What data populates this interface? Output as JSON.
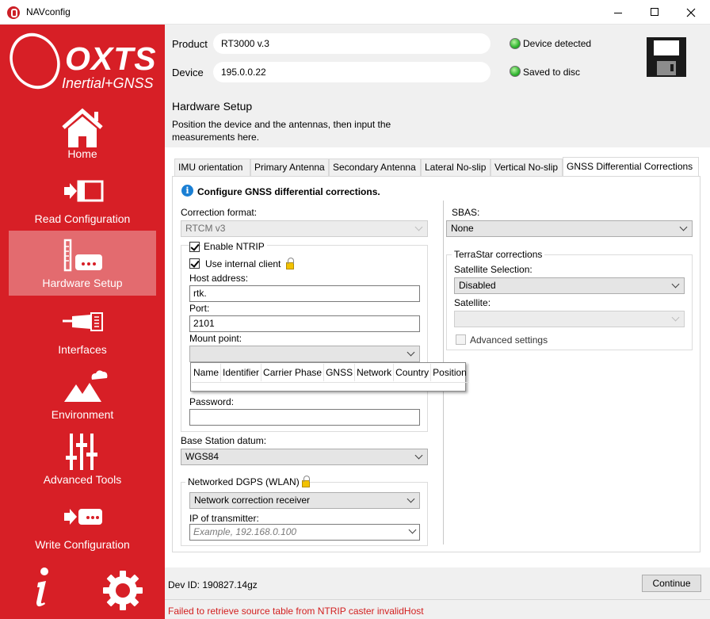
{
  "window": {
    "title": "NAVconfig",
    "controls": [
      "minimize",
      "maximize",
      "close"
    ]
  },
  "sidebar": {
    "logo": {
      "brand": "OXTS",
      "tagline": "Inertial+GNSS"
    },
    "items": [
      {
        "label": "Home",
        "icon": "home-icon",
        "active": false
      },
      {
        "label": "Read Configuration",
        "icon": "read-config-icon",
        "active": false
      },
      {
        "label": "Hardware Setup",
        "icon": "hardware-setup-icon",
        "active": true
      },
      {
        "label": "Interfaces",
        "icon": "interfaces-icon",
        "active": false
      },
      {
        "label": "Environment",
        "icon": "environment-icon",
        "active": false
      },
      {
        "label": "Advanced Tools",
        "icon": "advanced-tools-icon",
        "active": false
      },
      {
        "label": "Write Configuration",
        "icon": "write-config-icon",
        "active": false
      }
    ],
    "bottom_icons": [
      "info-icon",
      "settings-gear-icon"
    ]
  },
  "header": {
    "product_label": "Product",
    "product_value": "RT3000 v.3",
    "device_label": "Device",
    "device_value": "195.0.0.22",
    "status_device": "Device detected",
    "status_saved": "Saved to disc",
    "status_color": "#2fb52f",
    "save_icon": "floppy-disk-icon"
  },
  "page": {
    "title": "Hardware Setup",
    "description": "Position the device and the antennas, then input the measurements here."
  },
  "tabs": [
    {
      "label": "IMU orientation",
      "active": false
    },
    {
      "label": "Primary Antenna",
      "active": false
    },
    {
      "label": "Secondary Antenna",
      "active": false
    },
    {
      "label": "Lateral No-slip",
      "active": false
    },
    {
      "label": "Vertical No-slip",
      "active": false
    },
    {
      "label": "GNSS Differential Corrections",
      "active": true
    }
  ],
  "gnss": {
    "info_text": "Configure GNSS differential corrections.",
    "correction_format_label": "Correction format:",
    "correction_format_value": "RTCM v3",
    "enable_ntrip_label": "Enable NTRIP",
    "enable_ntrip_checked": true,
    "use_internal_client_label": "Use internal client",
    "use_internal_client_checked": true,
    "host_address_label": "Host address:",
    "host_address_value": "rtk.",
    "port_label": "Port:",
    "port_value": "2101",
    "mount_point_label": "Mount point:",
    "mount_point_value": "",
    "mount_point_columns": [
      "Name",
      "Identifier",
      "Carrier Phase",
      "GNSS",
      "Network",
      "Country",
      "Position"
    ],
    "password_label": "Password:",
    "password_value": "",
    "base_station_datum_label": "Base Station datum:",
    "base_station_datum_value": "WGS84",
    "networked_dgps_label": "Networked DGPS (WLAN)",
    "networked_dgps_mode_value": "Network correction receiver",
    "ip_transmitter_label": "IP of transmitter:",
    "ip_transmitter_placeholder": "Example, 192.168.0.100",
    "sbas_label": "SBAS:",
    "sbas_value": "None",
    "terrastar_title": "TerraStar corrections",
    "satellite_selection_label": "Satellite Selection:",
    "satellite_selection_value": "Disabled",
    "satellite_label": "Satellite:",
    "satellite_value": "",
    "advanced_settings_label": "Advanced settings",
    "advanced_settings_checked": false
  },
  "footer": {
    "dev_id": "Dev ID: 190827.14gz",
    "continue_label": "Continue",
    "status_message": "Failed to retrieve source table from NTRIP caster invalidHost",
    "status_color": "#d21f1f"
  }
}
